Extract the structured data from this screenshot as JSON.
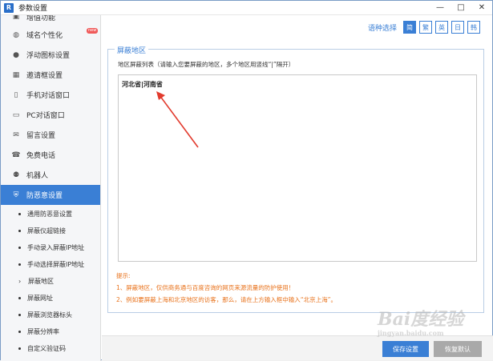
{
  "window": {
    "title": "参数设置",
    "app_icon": "R",
    "controls": [
      "—",
      "□",
      "✕"
    ]
  },
  "sidebar": {
    "items": [
      {
        "label": "增值功能",
        "icon": "puzzle-icon"
      },
      {
        "label": "域名个性化",
        "icon": "globe-icon",
        "badge": "new"
      },
      {
        "label": "浮动图标设置",
        "icon": "bulb-icon"
      },
      {
        "label": "邀请框设置",
        "icon": "grid-icon"
      },
      {
        "label": "手机对话窗口",
        "icon": "phone-icon"
      },
      {
        "label": "PC对话窗口",
        "icon": "monitor-icon"
      },
      {
        "label": "留言设置",
        "icon": "message-icon"
      },
      {
        "label": "免费电话",
        "icon": "telephone-icon"
      },
      {
        "label": "机器人",
        "icon": "robot-icon"
      },
      {
        "label": "防恶意设置",
        "icon": "shield-icon",
        "active": true
      }
    ],
    "sub_items": [
      {
        "label": "通用防恶意设置",
        "marker": "dot"
      },
      {
        "label": "屏蔽仪超链接",
        "marker": "dot"
      },
      {
        "label": "手动录入屏蔽IP地址",
        "marker": "dot"
      },
      {
        "label": "手动选择屏蔽IP地址",
        "marker": "dot"
      },
      {
        "label": "屏蔽地区",
        "marker": "chevron"
      },
      {
        "label": "屏蔽网址",
        "marker": "dot"
      },
      {
        "label": "屏蔽浏览器标头",
        "marker": "dot"
      },
      {
        "label": "屏蔽分辨率",
        "marker": "dot"
      },
      {
        "label": "自定义验证码",
        "marker": "dot"
      }
    ]
  },
  "language": {
    "label": "语种选择",
    "options": [
      "简",
      "繁",
      "英",
      "日",
      "韩"
    ],
    "selected": "简"
  },
  "panel": {
    "legend": "屏蔽地区",
    "list_hint": "地区屏蔽列表（请输入您要屏蔽的地区，多个地区用竖线“|”隔开）",
    "textarea_value": "河北省|河南省"
  },
  "tips": {
    "title": "提示:",
    "lines": [
      "1、屏蔽地区，仅供商务通与百度咨询的网页来源流量的防护使用！",
      "2、例如要屏蔽上海和北京地区的访客，那么，请在上方输入框中输入“北京上海”。"
    ]
  },
  "footer": {
    "save_label": "保存设置",
    "restore_label": "恢复默认"
  },
  "watermark": {
    "text": "Bai度经验",
    "sub": "jingyan.baidu.com"
  },
  "colors": {
    "accent": "#3a7fd5",
    "tip": "#e8711a",
    "arrow": "#e23b2e"
  }
}
